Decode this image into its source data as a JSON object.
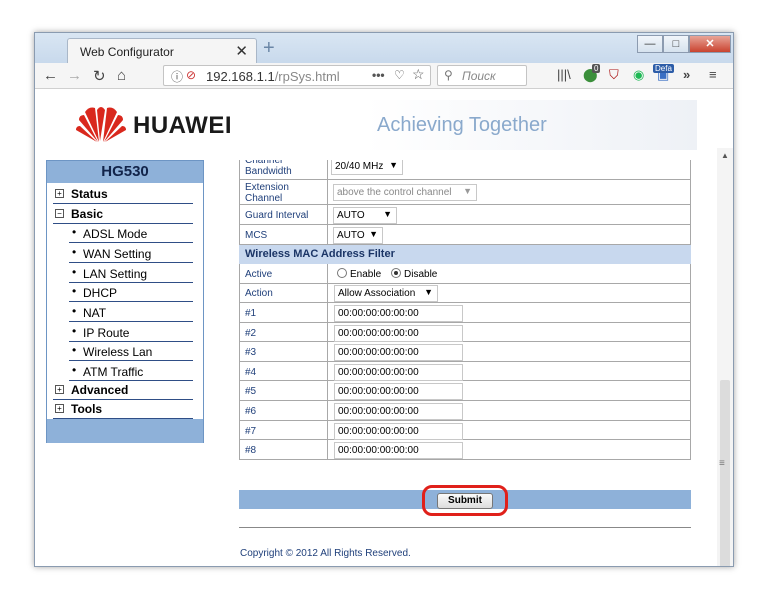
{
  "browser": {
    "tab_title": "Web Configurator",
    "tab_close": "✕",
    "new_tab": "+",
    "url_host": "192.168.1.1",
    "url_path": "/rpSys.html",
    "url_dots": "•••",
    "search_placeholder": "Поиск",
    "badge_update": "0",
    "badge_defa": "Defa",
    "win_min": "—",
    "win_max": "□",
    "win_close": "✕"
  },
  "banner": {
    "brand": "HUAWEI",
    "slogan": "Achieving Together"
  },
  "sidebar": {
    "header": "HG530",
    "status": "Status",
    "basic": "Basic",
    "sub_items": [
      "ADSL Mode",
      "WAN Setting",
      "LAN Setting",
      "DHCP",
      "NAT",
      "IP Route",
      "Wireless Lan",
      "ATM Traffic"
    ],
    "advanced": "Advanced",
    "tools": "Tools",
    "collapsed_symbol": "+",
    "expanded_symbol": "−"
  },
  "form": {
    "channel_bandwidth_label": "Channel Bandwidth",
    "channel_bandwidth_value": "20/40 MHz",
    "extension_channel_label": "Extension Channel",
    "extension_channel_value": "above the control channel",
    "guard_interval_label": "Guard Interval",
    "guard_interval_value": "AUTO",
    "mcs_label": "MCS",
    "mcs_value": "AUTO",
    "mac_filter_header": "Wireless MAC Address Filter",
    "active_label": "Active",
    "enable_label": "Enable",
    "disable_label": "Disable",
    "active_selected": "Disable",
    "action_label": "Action",
    "action_value": "Allow Association",
    "mac_entries": [
      {
        "label": "#1",
        "value": "00:00:00:00:00:00"
      },
      {
        "label": "#2",
        "value": "00:00:00:00:00:00"
      },
      {
        "label": "#3",
        "value": "00:00:00:00:00:00"
      },
      {
        "label": "#4",
        "value": "00:00:00:00:00:00"
      },
      {
        "label": "#5",
        "value": "00:00:00:00:00:00"
      },
      {
        "label": "#6",
        "value": "00:00:00:00:00:00"
      },
      {
        "label": "#7",
        "value": "00:00:00:00:00:00"
      },
      {
        "label": "#8",
        "value": "00:00:00:00:00:00"
      }
    ],
    "submit_label": "Submit"
  },
  "footer": {
    "copyright": "Copyright © 2012 All Rights Reserved."
  },
  "colors": {
    "nav_blue": "#8eb1d9",
    "section_blue": "#c8d8ee",
    "label_blue": "#1f3f7a",
    "highlight_red": "#e0201a",
    "logo_red": "#d9281d"
  },
  "icons": [
    "back-arrow-icon",
    "forward-arrow-icon",
    "reload-icon",
    "home-icon",
    "info-icon",
    "insecure-icon",
    "pocket-icon",
    "bookmark-star-icon",
    "search-icon",
    "library-icon",
    "ublock-icon",
    "spotify-icon",
    "overflow-chevron-icon",
    "hamburger-menu-icon"
  ]
}
